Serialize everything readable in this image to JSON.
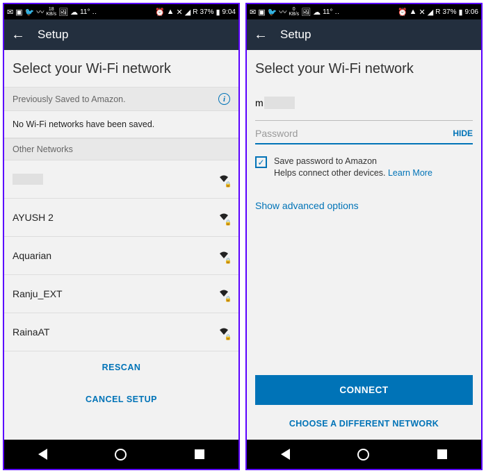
{
  "left": {
    "statusbar": {
      "speed_top": "18",
      "speed_bot": "KB/s",
      "temp": "11°",
      "signal": "R",
      "battery": "37%",
      "time": "9:04"
    },
    "appbar_title": "Setup",
    "heading": "Select your Wi-Fi network",
    "prev_saved_label": "Previously Saved to Amazon.",
    "no_saved": "No Wi-Fi networks have been saved.",
    "other_label": "Other Networks",
    "networks": [
      {
        "name": "",
        "redacted": true
      },
      {
        "name": "AYUSH 2"
      },
      {
        "name": "Aquarian"
      },
      {
        "name": "Ranju_EXT"
      },
      {
        "name": "RainaAT"
      }
    ],
    "rescan": "RESCAN",
    "cancel": "CANCEL SETUP"
  },
  "right": {
    "statusbar": {
      "speed_top": "0",
      "speed_bot": "KB/s",
      "temp": "11°",
      "signal": "R",
      "battery": "37%",
      "time": "9:06"
    },
    "appbar_title": "Setup",
    "heading": "Select your Wi-Fi network",
    "ssid_prefix": "m",
    "password_placeholder": "Password",
    "hide": "HIDE",
    "save_title": "Save password to Amazon",
    "save_sub": "Helps connect other devices. ",
    "learn_more": "Learn More",
    "advanced": "Show advanced options",
    "connect": "CONNECT",
    "choose": "CHOOSE A DIFFERENT NETWORK"
  }
}
